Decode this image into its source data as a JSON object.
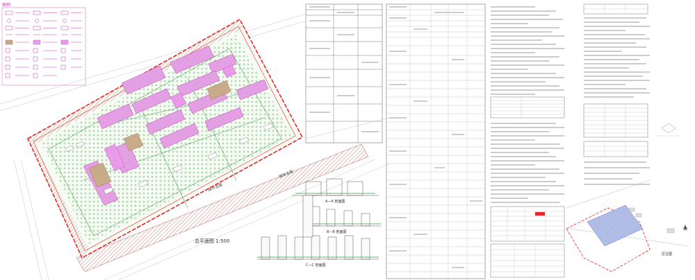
{
  "legend": {
    "title": "图例"
  },
  "site_plan": {
    "road_label": "城市支路",
    "scale_label": "总平面图 1:500"
  },
  "sections": {
    "section_a": "A—A 剖面图",
    "section_b": "B—B 剖面图",
    "section_c": "C—C 剖面图"
  },
  "location_map": {
    "title": "区位图"
  },
  "colors": {
    "boundary": "#e8282a",
    "building_fill": "#e79be8",
    "green": "#2e9a36",
    "road_hatch": "#b05a5a",
    "legend_text": "#c03fb0",
    "blue_fill": "#9aaad8",
    "linework": "#555555"
  }
}
